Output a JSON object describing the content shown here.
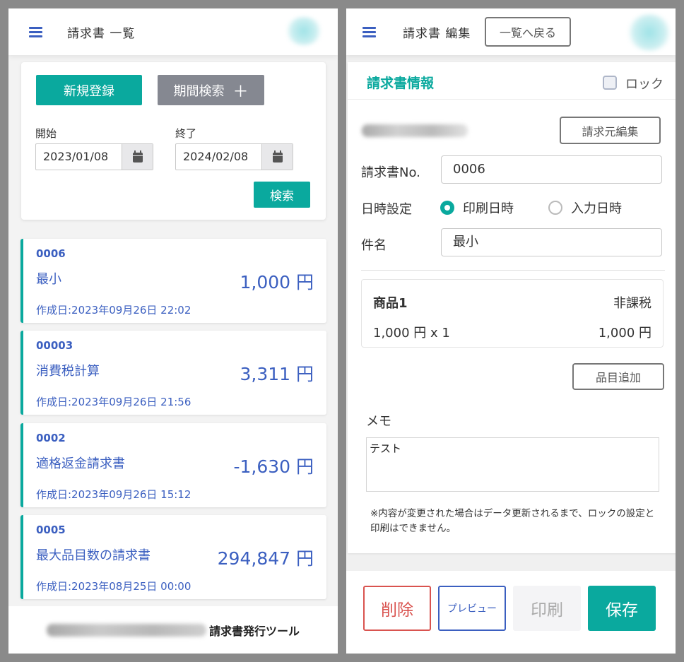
{
  "list_screen": {
    "title": "請求書 一覧",
    "new_button": "新規登録",
    "period_button": "期間検索",
    "period_button_icon": "＋",
    "start_label": "開始",
    "start_value": "2023/01/08",
    "end_label": "終了",
    "end_value": "2024/02/08",
    "search_button": "検索",
    "invoices": [
      {
        "no": "0006",
        "name": "最小",
        "amount": "1,000 円",
        "created": "作成日:2023年09月26日 22:02"
      },
      {
        "no": "00003",
        "name": "消費税計算",
        "amount": "3,311 円",
        "created": "作成日:2023年09月26日 21:56"
      },
      {
        "no": "0002",
        "name": "適格返金請求書",
        "amount": "-1,630 円",
        "created": "作成日:2023年09月26日 15:12"
      },
      {
        "no": "0005",
        "name": "最大品目数の請求書",
        "amount": "294,847 円",
        "created": "作成日:2023年08月25日 00:00"
      }
    ],
    "footer_tool": "請求書発行ツール"
  },
  "edit_screen": {
    "title": "請求書 編集",
    "back_button": "一覧へ戻る",
    "section_title": "請求書情報",
    "lock_label": "ロック",
    "issuer_edit_button": "請求元編集",
    "invoice_no_label": "請求書No.",
    "invoice_no_value": "0006",
    "datetime_label": "日時設定",
    "radio_print": "印刷日時",
    "radio_input": "入力日時",
    "subject_label": "件名",
    "subject_value": "最小",
    "item": {
      "name": "商品1",
      "tax": "非課税",
      "unit": "1,000 円 x 1",
      "total": "1,000 円"
    },
    "add_item_button": "品目追加",
    "memo_label": "メモ",
    "memo_value": "テスト",
    "note_line1": "※内容が変更された場合はデータ更新されるまで、ロックの設定と",
    "note_line2": "印刷はできません。",
    "delete_button": "削除",
    "preview_button": "プレビュー",
    "print_button": "印刷",
    "save_button": "保存"
  },
  "colors": {
    "accent": "#0aa99e",
    "link": "#3b5fc0",
    "danger": "#d9534f"
  },
  "icons": [
    "menu-icon",
    "calendar-icon",
    "plus-icon",
    "checkbox-icon",
    "radio-icon"
  ]
}
